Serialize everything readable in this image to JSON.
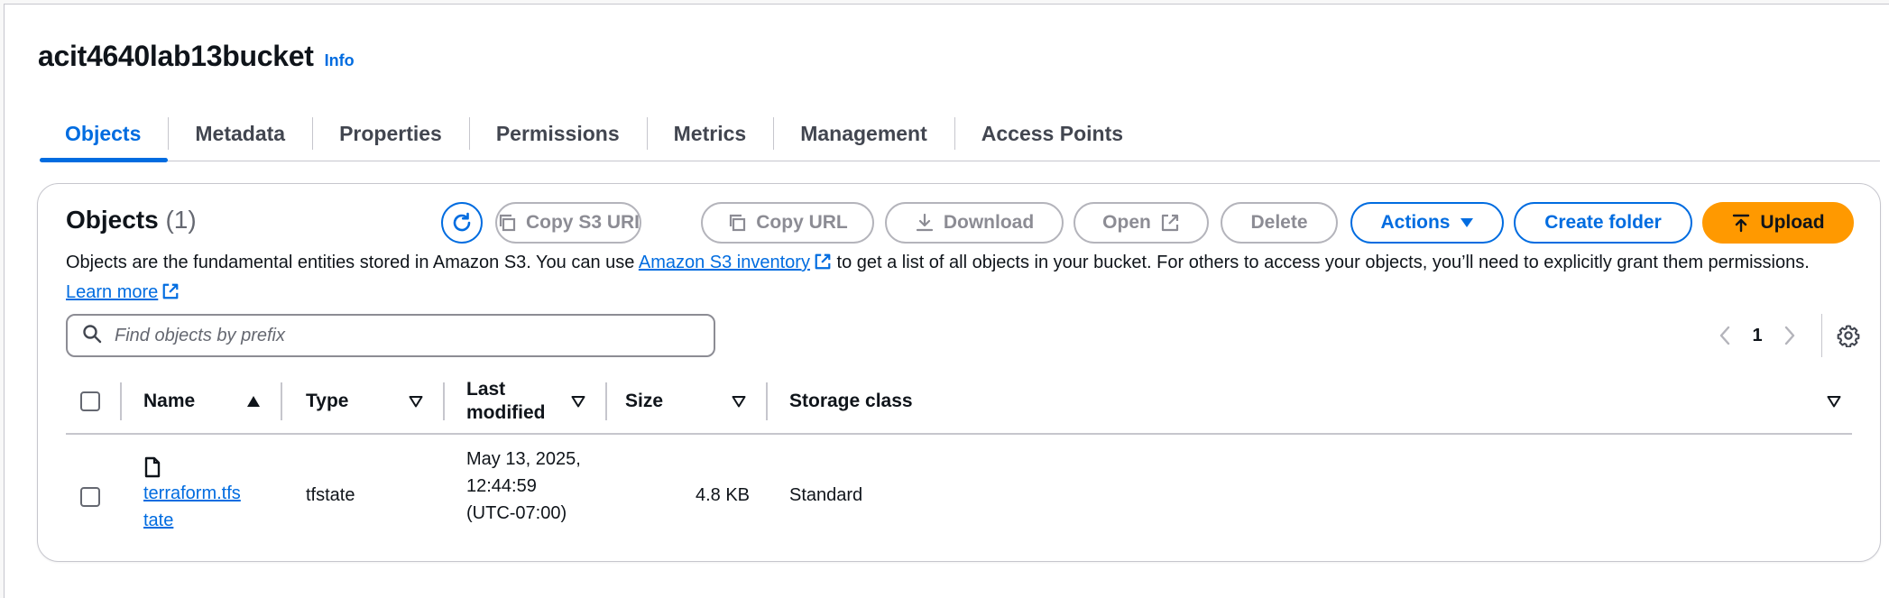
{
  "bucket": {
    "name": "acit4640lab13bucket",
    "info_label": "Info"
  },
  "tabs": [
    {
      "label": "Objects"
    },
    {
      "label": "Metadata"
    },
    {
      "label": "Properties"
    },
    {
      "label": "Permissions"
    },
    {
      "label": "Metrics"
    },
    {
      "label": "Management"
    },
    {
      "label": "Access Points"
    }
  ],
  "objects_panel": {
    "title": "Objects",
    "count": "(1)",
    "buttons": {
      "copy_s3_uri": "Copy S3 URI",
      "copy_url": "Copy URL",
      "download": "Download",
      "open": "Open",
      "delete": "Delete",
      "actions": "Actions",
      "create_folder": "Create folder",
      "upload": "Upload"
    },
    "description": {
      "part1": "Objects are the fundamental entities stored in Amazon S3. You can use ",
      "inventory_link": "Amazon S3 inventory",
      "part2": " to get a list of all objects in your bucket. For others to access your objects, you’ll need to explicitly grant them permissions. ",
      "learn_more": "Learn more"
    },
    "search": {
      "placeholder": "Find objects by prefix",
      "value": ""
    },
    "pagination": {
      "current_page": "1"
    },
    "table": {
      "columns": {
        "name": "Name",
        "type": "Type",
        "last_modified": "Last modified",
        "size": "Size",
        "storage_class": "Storage class"
      },
      "rows": [
        {
          "name": "terraform.tfstate",
          "type": "tfstate",
          "last_modified": "May 13, 2025, 12:44:59 (UTC-07:00)",
          "size": "4.8 KB",
          "storage_class": "Standard"
        }
      ]
    }
  },
  "colors": {
    "accent": "#006ce0",
    "upload": "#ff9900",
    "text": "#0f141a",
    "disabled": "#8c8c94",
    "border": "#c6c6cd"
  },
  "icons": [
    "refresh-icon",
    "copy-icon",
    "download-icon",
    "external-link-icon",
    "caret-down-icon",
    "upload-icon",
    "search-icon",
    "chevron-left-icon",
    "chevron-right-icon",
    "gear-icon",
    "sort-ascending-icon",
    "sort-caret-icon",
    "file-icon"
  ]
}
